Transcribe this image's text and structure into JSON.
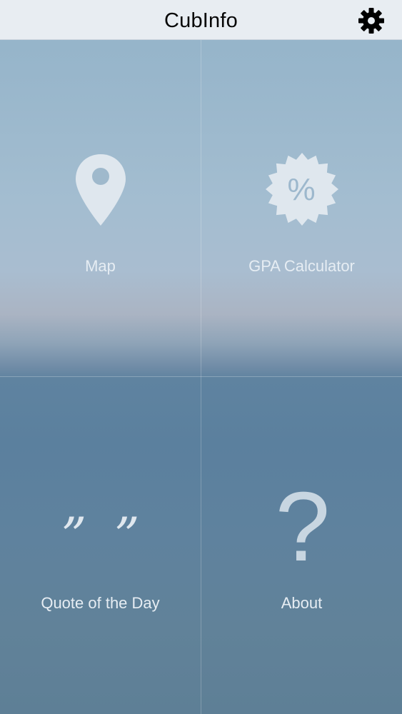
{
  "nav": {
    "title": "CubInfo",
    "settings_icon": "gear-icon"
  },
  "tiles": [
    {
      "label": "Map",
      "icon": "map-pin-icon"
    },
    {
      "label": "GPA Calculator",
      "icon": "percent-badge-icon"
    },
    {
      "label": "Quote of the Day",
      "icon": "quote-marks-icon",
      "glyph_left": "”",
      "glyph_right": "”"
    },
    {
      "label": "About",
      "icon": "question-mark-icon",
      "glyph": "?"
    }
  ],
  "colors": {
    "nav_background": "#e8edf2",
    "title_text": "#050505",
    "tile_label": "#e6edf3",
    "icon_fill": "#dfe7ee"
  }
}
